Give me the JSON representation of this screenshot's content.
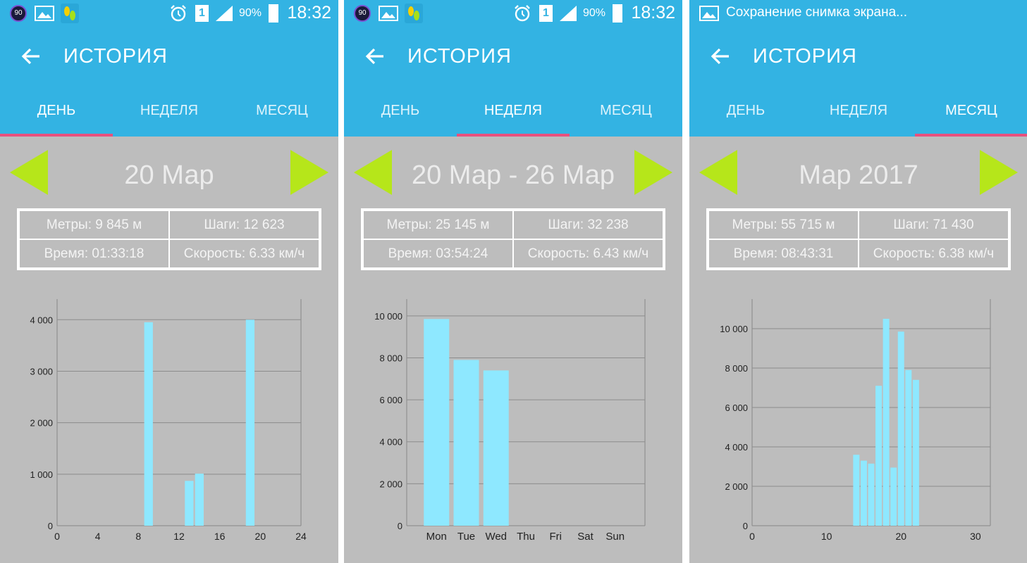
{
  "status_bar": {
    "badge": "90",
    "battery": "90%",
    "time": "18:32",
    "sim": "1",
    "notification": "Сохранение снимка экрана..."
  },
  "appbar": {
    "title": "ИСТОРИЯ"
  },
  "tabs": [
    "ДЕНЬ",
    "НЕДЕЛЯ",
    "МЕСЯЦ"
  ],
  "colors": {
    "primary": "#33b3e3",
    "accent": "#e8507e",
    "arrow": "#b6e61a",
    "bar": "#8ee8ff",
    "background": "#bdbdbd"
  },
  "panels": [
    {
      "active_tab": 0,
      "period": "20 Мар",
      "stats": {
        "meters": "Метры: 9 845 м",
        "steps": "Шаги: 12 623",
        "time": "Время: 01:33:18",
        "speed": "Скорость: 6.33 км/ч"
      }
    },
    {
      "active_tab": 1,
      "period": "20 Мар - 26 Мар",
      "stats": {
        "meters": "Метры: 25 145 м",
        "steps": "Шаги: 32 238",
        "time": "Время: 03:54:24",
        "speed": "Скорость: 6.43 км/ч"
      }
    },
    {
      "active_tab": 2,
      "period": "Мар 2017",
      "stats": {
        "meters": "Метры: 55 715 м",
        "steps": "Шаги: 71 430",
        "time": "Время: 08:43:31",
        "speed": "Скорость: 6.38 км/ч"
      }
    }
  ],
  "chart_data": [
    {
      "type": "bar",
      "x_ticks": [
        "0",
        "4",
        "8",
        "12",
        "16",
        "20",
        "24"
      ],
      "y_ticks": [
        "0",
        "1 000",
        "2 000",
        "3 000",
        "4 000"
      ],
      "xlim": [
        0,
        24
      ],
      "ylim": [
        0,
        4400
      ],
      "bars": [
        {
          "x": 9,
          "value": 3950
        },
        {
          "x": 13,
          "value": 870
        },
        {
          "x": 14,
          "value": 1010
        },
        {
          "x": 19,
          "value": 4000
        }
      ]
    },
    {
      "type": "bar",
      "categories": [
        "Mon",
        "Tue",
        "Wed",
        "Thu",
        "Fri",
        "Sat",
        "Sun"
      ],
      "values": [
        9850,
        7900,
        7400,
        0,
        0,
        0,
        0
      ],
      "y_ticks": [
        "0",
        "2 000",
        "4 000",
        "6 000",
        "8 000",
        "10 000"
      ],
      "ylim": [
        0,
        10800
      ]
    },
    {
      "type": "bar",
      "x_ticks": [
        "0",
        "10",
        "20",
        "30"
      ],
      "y_ticks": [
        "0",
        "2 000",
        "4 000",
        "6 000",
        "8 000",
        "10 000"
      ],
      "xlim": [
        0,
        32
      ],
      "ylim": [
        0,
        11500
      ],
      "bars": [
        {
          "x": 14,
          "value": 3600
        },
        {
          "x": 15,
          "value": 3300
        },
        {
          "x": 16,
          "value": 3150
        },
        {
          "x": 17,
          "value": 7100
        },
        {
          "x": 18,
          "value": 10500
        },
        {
          "x": 19,
          "value": 2950
        },
        {
          "x": 20,
          "value": 9850
        },
        {
          "x": 21,
          "value": 7900
        },
        {
          "x": 22,
          "value": 7400
        }
      ]
    }
  ]
}
